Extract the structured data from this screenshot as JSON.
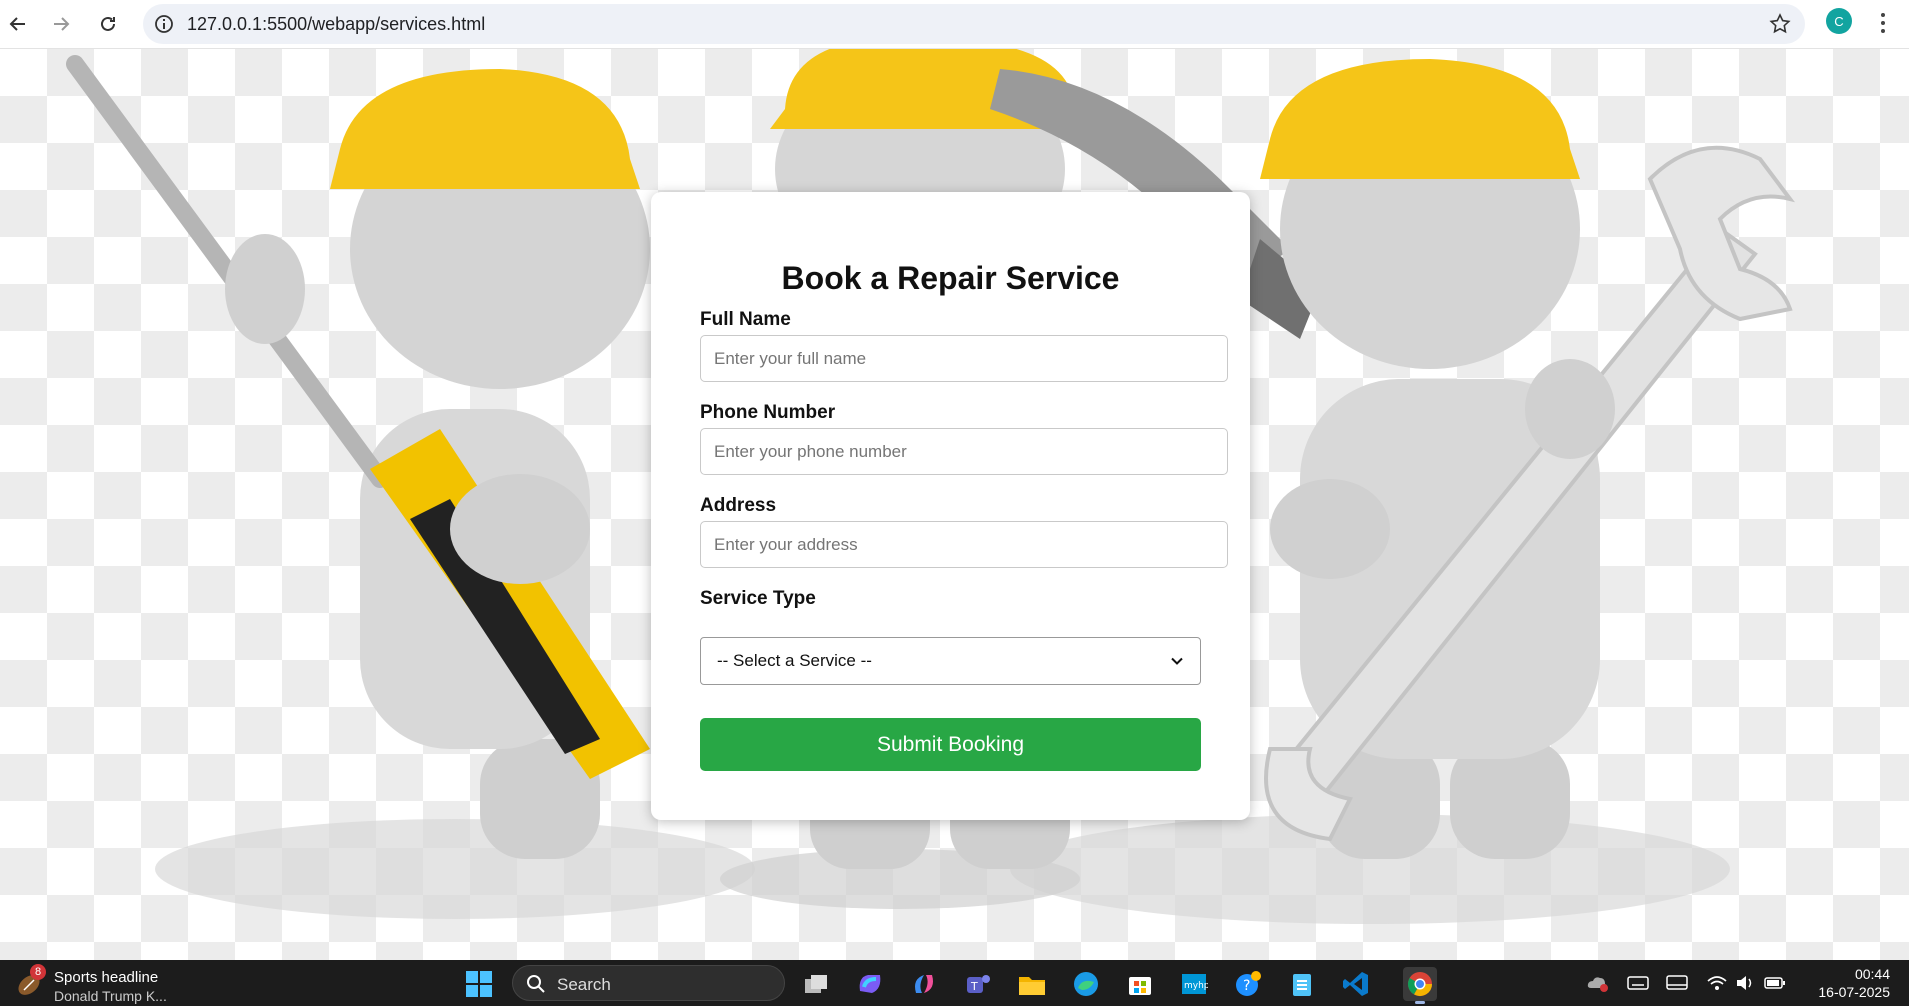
{
  "browser": {
    "url": "127.0.0.1:5500/webapp/services.html",
    "profile_initial": "C",
    "icons": [
      "back-arrow-icon",
      "forward-arrow-icon",
      "reload-icon",
      "site-info-icon",
      "bookmark-star-icon",
      "more-menu-icon"
    ]
  },
  "form": {
    "title": "Book a Repair Service",
    "full_name_label": "Full Name",
    "full_name_placeholder": "Enter your full name",
    "phone_label": "Phone Number",
    "phone_placeholder": "Enter your phone number",
    "address_label": "Address",
    "address_placeholder": "Enter your address",
    "service_label": "Service Type",
    "service_selected": "-- Select a Service --",
    "submit_label": "Submit Booking",
    "submit_color": "#28a745"
  },
  "taskbar": {
    "news_badge": "8",
    "news_title": "Sports headline",
    "news_subtitle": "Donald Trump K...",
    "search_placeholder": "Search",
    "apps": [
      "task-view",
      "m365-copilot",
      "copilot",
      "teams",
      "file-explorer",
      "edge",
      "microsoft-store",
      "myhp",
      "get-help",
      "notepad",
      "vscode",
      "chrome"
    ],
    "time": "00:44",
    "date": "16-07-2025"
  }
}
